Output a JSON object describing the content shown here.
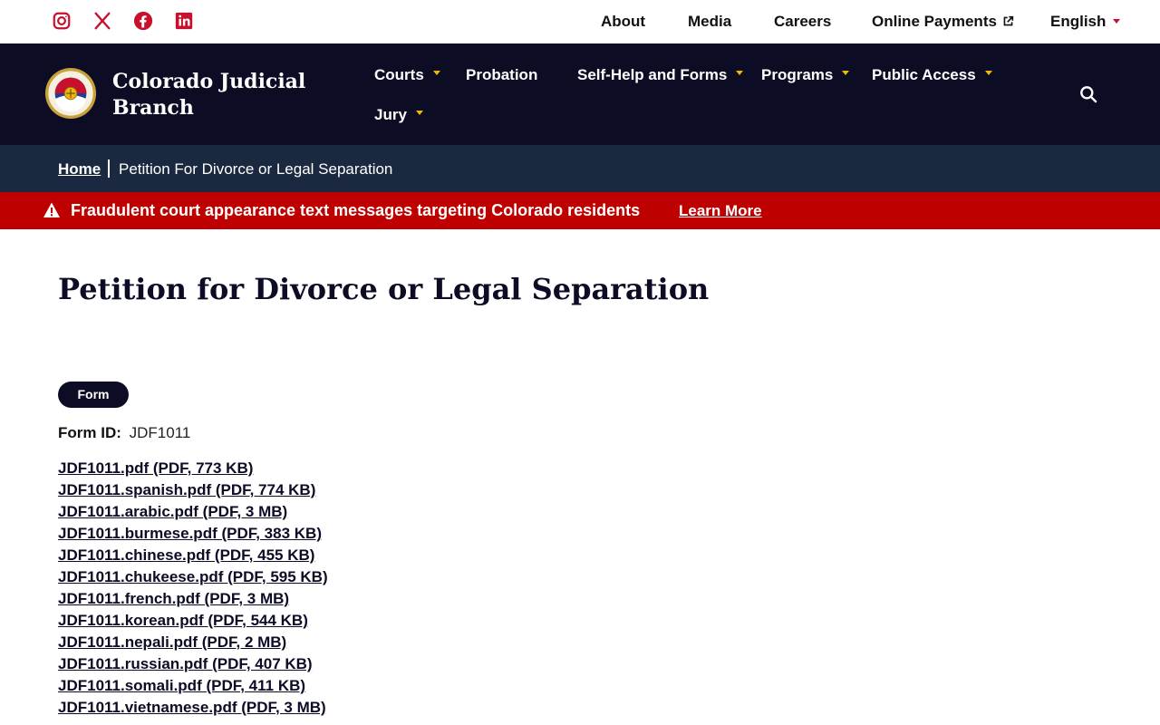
{
  "social": [
    {
      "name": "instagram-icon"
    },
    {
      "name": "x-icon"
    },
    {
      "name": "facebook-icon"
    },
    {
      "name": "linkedin-icon"
    }
  ],
  "utility_nav": {
    "about": "About",
    "media": "Media",
    "careers": "Careers",
    "online_payments": "Online Payments",
    "language": "English"
  },
  "brand": {
    "line1": "Colorado Judicial",
    "line2": "Branch"
  },
  "main_nav": {
    "courts": "Courts",
    "probation": "Probation",
    "self_help": "Self-Help and Forms",
    "programs": "Programs",
    "public_access": "Public Access",
    "jury": "Jury"
  },
  "breadcrumb": {
    "home": "Home",
    "current": "Petition For Divorce or Legal Separation"
  },
  "alert": {
    "message": "Fraudulent court appearance text messages targeting Colorado residents",
    "link": "Learn More"
  },
  "page": {
    "title": "Petition for Divorce or Legal Separation",
    "badge": "Form",
    "form_id_label": "Form ID:",
    "form_id_value": "JDF1011"
  },
  "files": [
    "JDF1011.pdf (PDF, 773 KB)",
    "JDF1011.spanish.pdf (PDF, 774 KB)",
    "JDF1011.arabic.pdf (PDF, 3 MB)",
    "JDF1011.burmese.pdf (PDF, 383 KB)",
    "JDF1011.chinese.pdf (PDF, 455 KB)",
    "JDF1011.chukeese.pdf (PDF, 595 KB)",
    "JDF1011.french.pdf (PDF, 3 MB)",
    "JDF1011.korean.pdf (PDF, 544 KB)",
    "JDF1011.nepali.pdf (PDF, 2 MB)",
    "JDF1011.russian.pdf (PDF, 407 KB)",
    "JDF1011.somali.pdf (PDF, 411 KB)",
    "JDF1011.vietnamese.pdf (PDF, 3 MB)"
  ],
  "colors": {
    "navy": "#0c0c25",
    "breadcrumb_bg": "#1b2940",
    "alert_red": "#bf0000",
    "accent_gold": "#f2b705",
    "social_red": "#c8102e"
  }
}
